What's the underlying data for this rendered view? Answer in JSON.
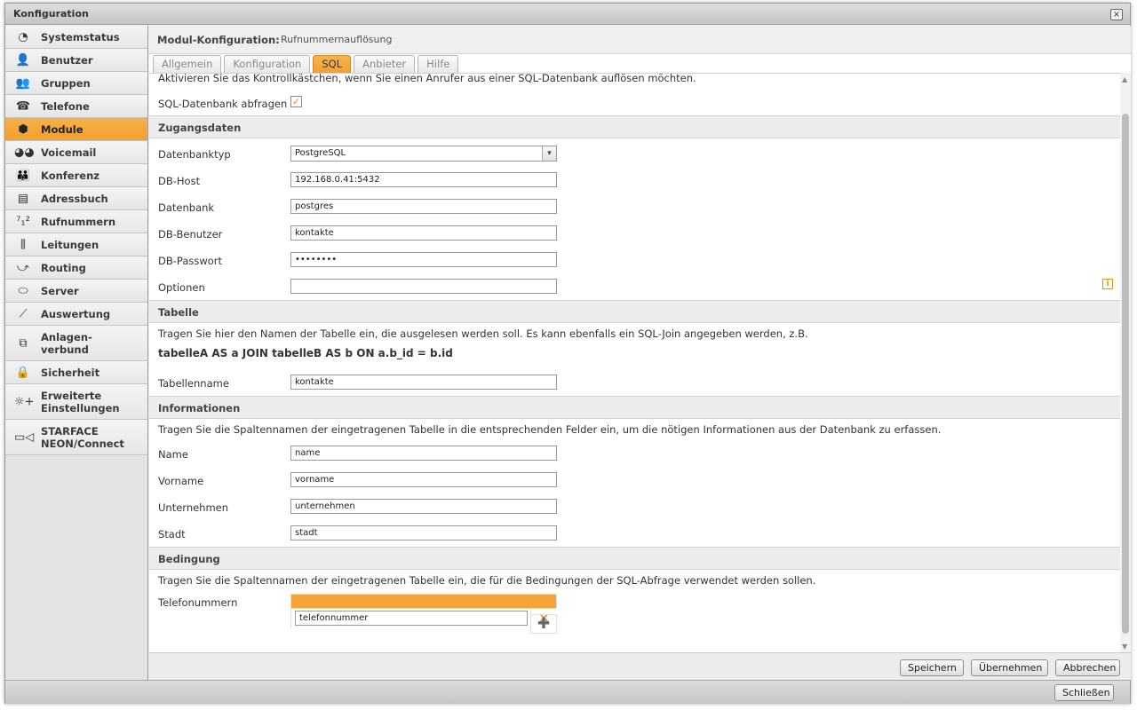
{
  "window": {
    "title": "Konfiguration",
    "close_label": "×"
  },
  "sidebar": {
    "items": [
      {
        "label": "Systemstatus",
        "icon": "◔"
      },
      {
        "label": "Benutzer",
        "icon": "👤"
      },
      {
        "label": "Gruppen",
        "icon": "👥"
      },
      {
        "label": "Telefone",
        "icon": "☎"
      },
      {
        "label": "Module",
        "icon": "⬢"
      },
      {
        "label": "Voicemail",
        "icon": "◕◕"
      },
      {
        "label": "Konferenz",
        "icon": "👪"
      },
      {
        "label": "Adressbuch",
        "icon": "▤"
      },
      {
        "label": "Rufnummern",
        "icon": "⁷₁²"
      },
      {
        "label": "Leitungen",
        "icon": "⫼"
      },
      {
        "label": "Routing",
        "icon": "⤻"
      },
      {
        "label": "Server",
        "icon": "⬭"
      },
      {
        "label": "Auswertung",
        "icon": "⟋"
      },
      {
        "label": "Anlagen-\nverbund",
        "icon": "⧉"
      },
      {
        "label": "Sicherheit",
        "icon": "🔒"
      },
      {
        "label": "Erweiterte\nEinstellungen",
        "icon": "☼+"
      },
      {
        "label": "STARFACE\nNEON/Connect",
        "icon": "▭◁"
      }
    ]
  },
  "header": {
    "key": "Modul-Konfiguration:",
    "value": "Rufnummernauflösung"
  },
  "tabs": [
    "Allgemein",
    "Konfiguration",
    "SQL",
    "Anbieter",
    "Hilfe"
  ],
  "content": {
    "intro": "Aktivieren Sie das Kontrollkästchen, wenn Sie einen Anrufer aus einer SQL-Datenbank auflösen möchten.",
    "sql_query_label": "SQL-Datenbank abfragen",
    "sql_query_checked": "✓",
    "section_access": "Zugangsdaten",
    "db_type_label": "Datenbanktyp",
    "db_type_value": "PostgreSQL",
    "db_host_label": "DB-Host",
    "db_host_value": "192.168.0.41:5432",
    "database_label": "Datenbank",
    "database_value": "postgres",
    "db_user_label": "DB-Benutzer",
    "db_user_value": "kontakte",
    "db_password_label": "DB-Passwort",
    "db_password_value": "••••••••",
    "options_label": "Optionen",
    "options_value": "",
    "section_table": "Tabelle",
    "table_hint": "Tragen Sie hier den Namen der Tabelle ein, die ausgelesen werden soll. Es kann ebenfalls ein SQL-Join angegeben werden, z.B.",
    "table_example": "tabelleA AS a JOIN tabelleB AS b ON a.b_id = b.id",
    "table_name_label": "Tabellenname",
    "table_name_value": "kontakte",
    "section_info": "Informationen",
    "info_hint": "Tragen Sie die Spaltennamen der eingetragenen Tabelle in die entsprechenden Felder ein, um die nötigen Informationen aus der Datenbank zu erfassen.",
    "name_label": "Name",
    "name_value": "name",
    "firstname_label": "Vorname",
    "firstname_value": "vorname",
    "company_label": "Unternehmen",
    "company_value": "unternehmen",
    "city_label": "Stadt",
    "city_value": "stadt",
    "section_condition": "Bedingung",
    "condition_hint": "Tragen Sie die Spaltennamen der eingetragenen Tabelle ein, die für die Bedingungen der SQL-Abfrage verwendet werden sollen.",
    "phone_label": "Telefonummern",
    "phone_value": "telefonnummer"
  },
  "footer": {
    "save": "Speichern",
    "apply": "Übernehmen",
    "cancel": "Abbrechen"
  },
  "bottombar": {
    "close": "Schließen"
  },
  "colors": {
    "accent": "#f5a236",
    "active_nav": "#f3a02e"
  }
}
